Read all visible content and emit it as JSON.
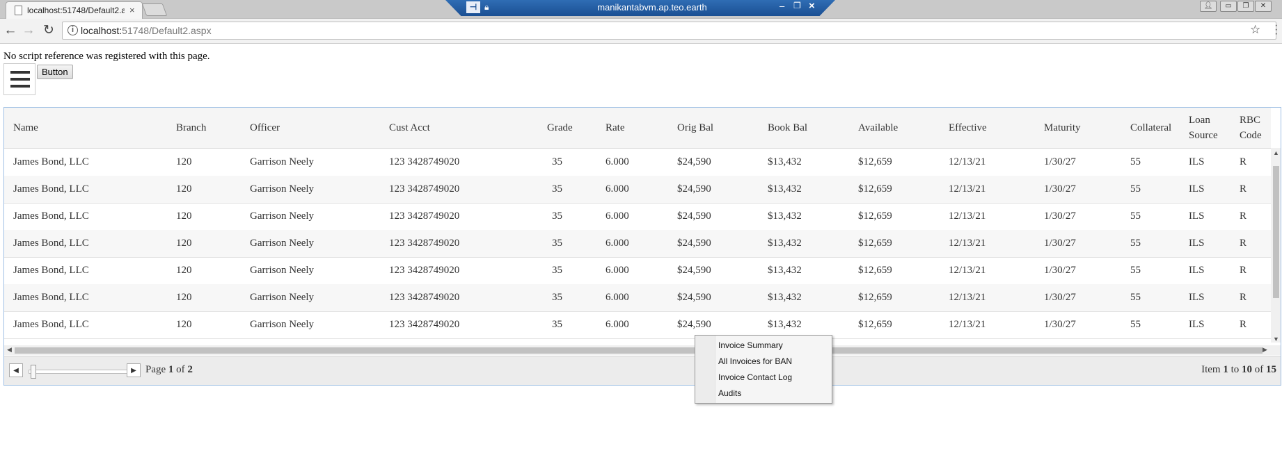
{
  "browser": {
    "tab_title": "localhost:51748/Default2.aspx",
    "tab_close": "×",
    "url_host": "localhost:",
    "url_path": "51748/Default2.aspx",
    "remote_title": "manikantabvm.ap.teo.earth"
  },
  "page": {
    "message": "No script reference was registered with this page.",
    "button_label": "Button"
  },
  "grid": {
    "columns": [
      "Name",
      "Branch",
      "Officer",
      "Cust Acct",
      "Grade",
      "Rate",
      "Orig Bal",
      "Book Bal",
      "Available",
      "Effective",
      "Maturity",
      "Collateral",
      "Loan Source",
      "RBC Code"
    ],
    "rows": [
      [
        "James Bond, LLC",
        "120",
        "Garrison Neely",
        "123 3428749020",
        "35",
        "6.000",
        "$24,590",
        "$13,432",
        "$12,659",
        "12/13/21",
        "1/30/27",
        "55",
        "ILS",
        "R"
      ],
      [
        "James Bond, LLC",
        "120",
        "Garrison Neely",
        "123 3428749020",
        "35",
        "6.000",
        "$24,590",
        "$13,432",
        "$12,659",
        "12/13/21",
        "1/30/27",
        "55",
        "ILS",
        "R"
      ],
      [
        "James Bond, LLC",
        "120",
        "Garrison Neely",
        "123 3428749020",
        "35",
        "6.000",
        "$24,590",
        "$13,432",
        "$12,659",
        "12/13/21",
        "1/30/27",
        "55",
        "ILS",
        "R"
      ],
      [
        "James Bond, LLC",
        "120",
        "Garrison Neely",
        "123 3428749020",
        "35",
        "6.000",
        "$24,590",
        "$13,432",
        "$12,659",
        "12/13/21",
        "1/30/27",
        "55",
        "ILS",
        "R"
      ],
      [
        "James Bond, LLC",
        "120",
        "Garrison Neely",
        "123 3428749020",
        "35",
        "6.000",
        "$24,590",
        "$13,432",
        "$12,659",
        "12/13/21",
        "1/30/27",
        "55",
        "ILS",
        "R"
      ],
      [
        "James Bond, LLC",
        "120",
        "Garrison Neely",
        "123 3428749020",
        "35",
        "6.000",
        "$24,590",
        "$13,432",
        "$12,659",
        "12/13/21",
        "1/30/27",
        "55",
        "ILS",
        "R"
      ],
      [
        "James Bond, LLC",
        "120",
        "Garrison Neely",
        "123 3428749020",
        "35",
        "6.000",
        "$24,590",
        "$13,432",
        "$12,659",
        "12/13/21",
        "1/30/27",
        "55",
        "ILS",
        "R"
      ]
    ]
  },
  "pager": {
    "page_prefix": "Page",
    "page_current": "1",
    "page_of": "of",
    "page_total": "2",
    "items_prefix": "Item",
    "items_from": "1",
    "items_to_word": "to",
    "items_to": "10",
    "items_of": "of",
    "items_total": "15"
  },
  "context_menu": {
    "items": [
      "Invoice Summary",
      "All Invoices for BAN",
      "Invoice Contact Log",
      "Audits"
    ]
  }
}
